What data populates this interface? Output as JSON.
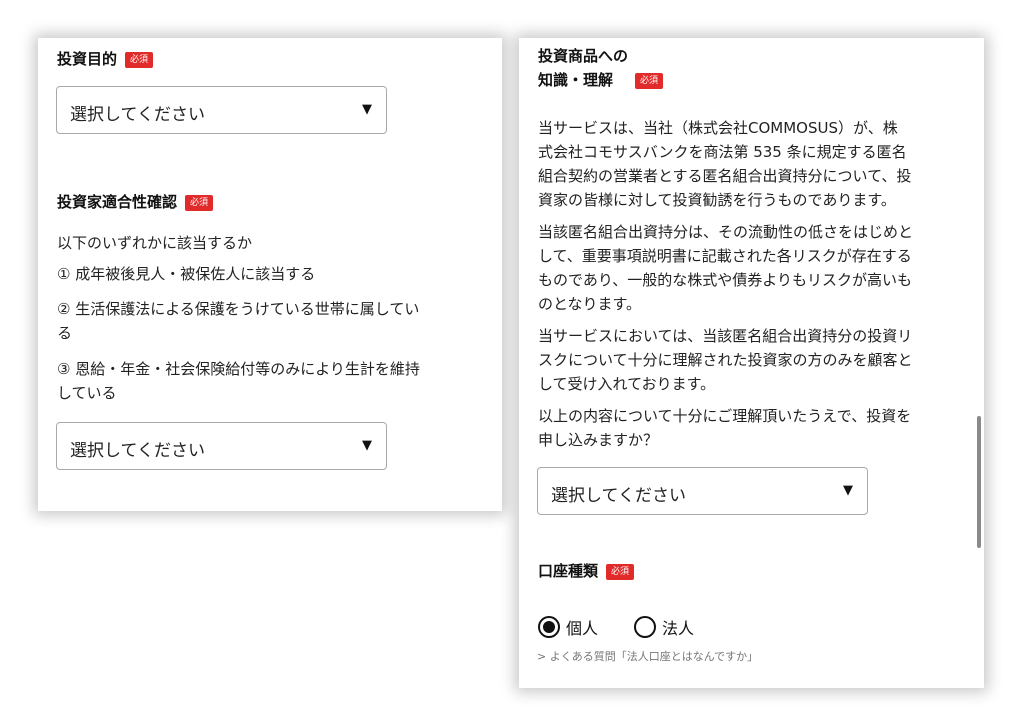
{
  "badges": {
    "required": "必須"
  },
  "left": {
    "purpose": {
      "title": "投資目的",
      "select_value": "選択してください"
    },
    "suitability": {
      "title": "投資家適合性確認",
      "intro": "以下のいずれかに該当するか",
      "item1": "① 成年被後見人・被保佐人に該当する",
      "item2_line1": "② 生活保護法による保護をうけている世帯に属してい",
      "item2_line2": "る",
      "item3_line1": "③ 恩給・年金・社会保険給付等のみにより生計を維持",
      "item3_line2": "している",
      "select_value": "選択してください"
    }
  },
  "right": {
    "knowledge": {
      "title_line1": "投資商品への",
      "title_line2": "知識・理解",
      "para1": [
        "当サービスは、当社（株式会社COMMOSUS）が、株",
        "式会社コモサスバンクを商法第 535 条に規定する匿名",
        "組合契約の営業者とする匿名組合出資持分について、投",
        "資家の皆様に対して投資勧誘を行うものであります。"
      ],
      "para2": [
        "当該匿名組合出資持分は、その流動性の低さをはじめと",
        "して、重要事項説明書に記載された各リスクが存在する",
        "ものであり、一般的な株式や債券よりもリスクが高いも",
        "のとなります。"
      ],
      "para3": [
        "当サービスにおいては、当該匿名組合出資持分の投資リ",
        "スクについて十分に理解された投資家の方のみを顧客と",
        "して受け入れております。"
      ],
      "para4": [
        "以上の内容について十分にご理解頂いたうえで、投資を",
        "申し込みますか？"
      ],
      "select_value": "選択してください"
    },
    "account_type": {
      "title": "口座種類",
      "options": [
        "個人",
        "法人"
      ],
      "selected": "個人",
      "faq_link": "> よくある質問「法人口座とはなんですか」"
    }
  },
  "colors": {
    "badge": "#e12a2a"
  },
  "icons": {
    "select_arrow": "▼"
  }
}
